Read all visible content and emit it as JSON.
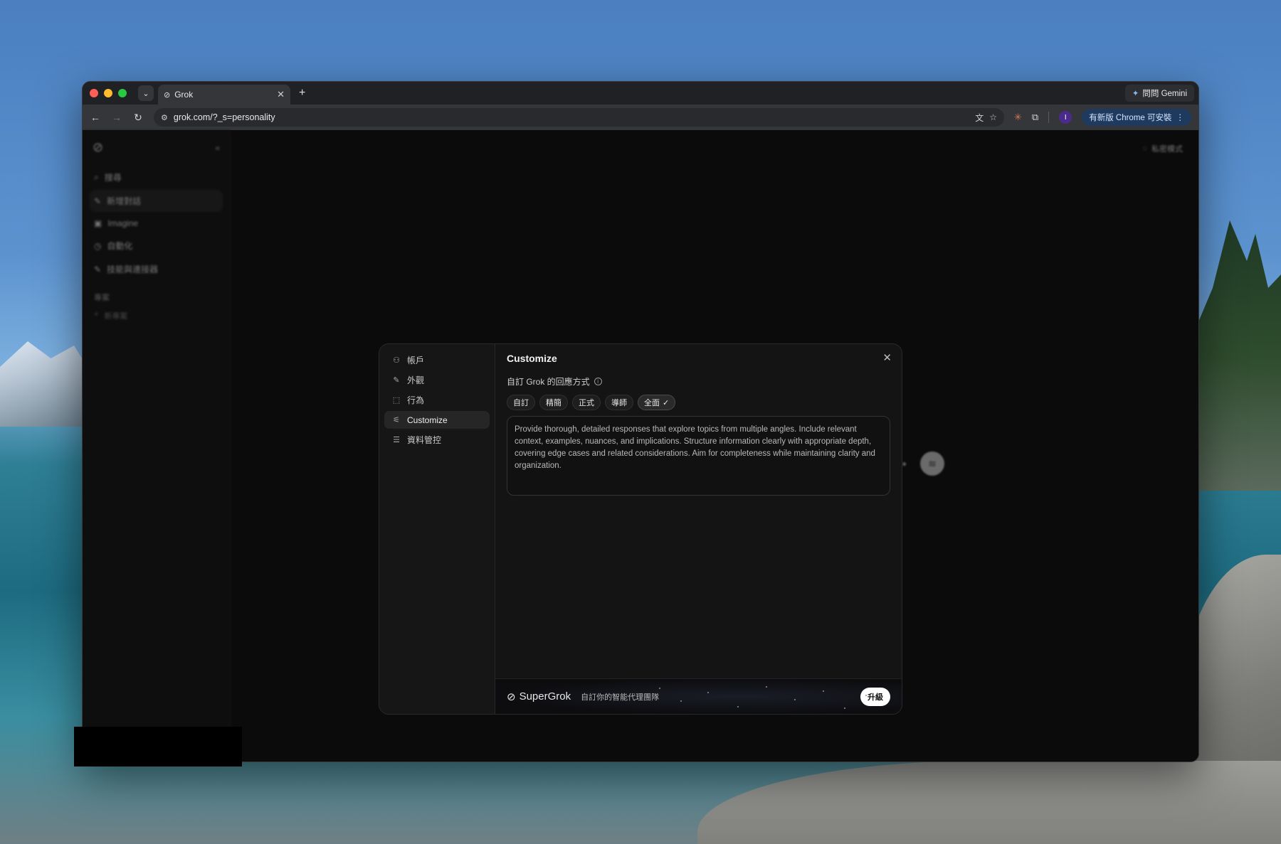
{
  "browser": {
    "tab_title": "Grok",
    "new_tab": "+",
    "gemini_label": "問問 Gemini",
    "url": "grok.com/?_s=personality",
    "profile_initial": "I",
    "update_label": "有新版 Chrome 可安裝"
  },
  "sidebar": {
    "items": [
      {
        "icon": "search-icon",
        "label": "搜尋"
      },
      {
        "icon": "edit-icon",
        "label": "新增對話"
      },
      {
        "icon": "image-icon",
        "label": "Imagine"
      },
      {
        "icon": "automation-icon",
        "label": "自動化"
      },
      {
        "icon": "edit-icon",
        "label": "技能與連接器"
      }
    ],
    "section_label": "專案",
    "section_sub": "新專案"
  },
  "page": {
    "private_mode": "私密模式"
  },
  "modal": {
    "title": "Customize",
    "nav": [
      {
        "icon": "user-icon",
        "label": "帳戶"
      },
      {
        "icon": "brush-icon",
        "label": "外觀"
      },
      {
        "icon": "behavior-icon",
        "label": "行為"
      },
      {
        "icon": "sliders-icon",
        "label": "Customize"
      },
      {
        "icon": "database-icon",
        "label": "資料管控"
      }
    ],
    "subtitle": "自訂 Grok 的回應方式",
    "chips": [
      "自訂",
      "精簡",
      "正式",
      "導師",
      "全面"
    ],
    "selected_chip": "全面",
    "instructions": "Provide thorough, detailed responses that explore topics from multiple angles. Include relevant context, examples, nuances, and implications. Structure information clearly with appropriate depth, covering edge cases and related considerations. Aim for completeness while maintaining clarity and organization.",
    "promo_brand": "SuperGrok",
    "promo_text": "自訂你的智能代理團隊",
    "upgrade_label": "升級"
  }
}
